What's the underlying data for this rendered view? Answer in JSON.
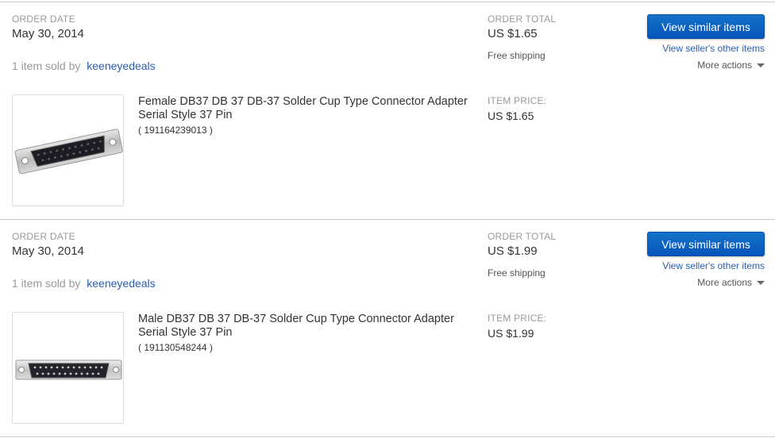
{
  "orders": [
    {
      "order_date_label": "ORDER DATE",
      "order_date": "May 30, 2014",
      "order_total_label": "ORDER TOTAL",
      "order_total": "US $1.65",
      "shipping": "Free shipping",
      "sold_prefix": "1 item sold by",
      "seller": "keeneyedeals",
      "btn_label": "View similar items",
      "other_items_label": "View seller's other items",
      "more_actions_label": "More actions",
      "item_title": "Female DB37 DB 37 DB-37 Solder Cup Type Connector Adapter Serial Style 37 Pin",
      "item_number": "( 191164239013 )",
      "item_price_label": "ITEM PRICE:",
      "item_price": "US $1.65"
    },
    {
      "order_date_label": "ORDER DATE",
      "order_date": "May 30, 2014",
      "order_total_label": "ORDER TOTAL",
      "order_total": "US $1.99",
      "shipping": "Free shipping",
      "sold_prefix": "1 item sold by",
      "seller": "keeneyedeals",
      "btn_label": "View similar items",
      "other_items_label": "View seller's other items",
      "more_actions_label": "More actions",
      "item_title": "Male DB37 DB 37 DB-37 Solder Cup Type Connector Adapter Serial Style 37 Pin",
      "item_number": "( 191130548244 )",
      "item_price_label": "ITEM PRICE:",
      "item_price": "US $1.99"
    }
  ],
  "colors": {
    "link": "#2a5db0",
    "button": "#0654ba"
  }
}
